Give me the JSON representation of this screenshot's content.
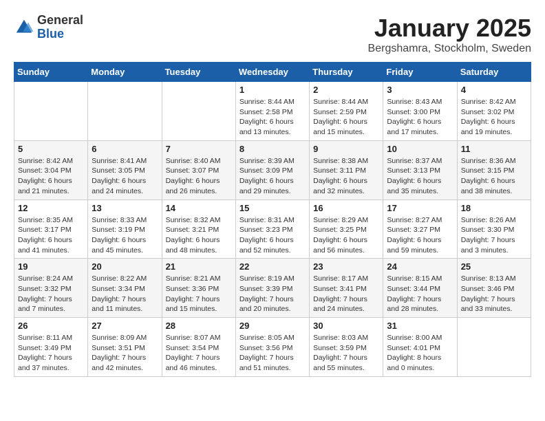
{
  "logo": {
    "general": "General",
    "blue": "Blue"
  },
  "header": {
    "title": "January 2025",
    "subtitle": "Bergshamra, Stockholm, Sweden"
  },
  "weekdays": [
    "Sunday",
    "Monday",
    "Tuesday",
    "Wednesday",
    "Thursday",
    "Friday",
    "Saturday"
  ],
  "weeks": [
    [
      {
        "day": "",
        "info": ""
      },
      {
        "day": "",
        "info": ""
      },
      {
        "day": "",
        "info": ""
      },
      {
        "day": "1",
        "info": "Sunrise: 8:44 AM\nSunset: 2:58 PM\nDaylight: 6 hours\nand 13 minutes."
      },
      {
        "day": "2",
        "info": "Sunrise: 8:44 AM\nSunset: 2:59 PM\nDaylight: 6 hours\nand 15 minutes."
      },
      {
        "day": "3",
        "info": "Sunrise: 8:43 AM\nSunset: 3:00 PM\nDaylight: 6 hours\nand 17 minutes."
      },
      {
        "day": "4",
        "info": "Sunrise: 8:42 AM\nSunset: 3:02 PM\nDaylight: 6 hours\nand 19 minutes."
      }
    ],
    [
      {
        "day": "5",
        "info": "Sunrise: 8:42 AM\nSunset: 3:04 PM\nDaylight: 6 hours\nand 21 minutes."
      },
      {
        "day": "6",
        "info": "Sunrise: 8:41 AM\nSunset: 3:05 PM\nDaylight: 6 hours\nand 24 minutes."
      },
      {
        "day": "7",
        "info": "Sunrise: 8:40 AM\nSunset: 3:07 PM\nDaylight: 6 hours\nand 26 minutes."
      },
      {
        "day": "8",
        "info": "Sunrise: 8:39 AM\nSunset: 3:09 PM\nDaylight: 6 hours\nand 29 minutes."
      },
      {
        "day": "9",
        "info": "Sunrise: 8:38 AM\nSunset: 3:11 PM\nDaylight: 6 hours\nand 32 minutes."
      },
      {
        "day": "10",
        "info": "Sunrise: 8:37 AM\nSunset: 3:13 PM\nDaylight: 6 hours\nand 35 minutes."
      },
      {
        "day": "11",
        "info": "Sunrise: 8:36 AM\nSunset: 3:15 PM\nDaylight: 6 hours\nand 38 minutes."
      }
    ],
    [
      {
        "day": "12",
        "info": "Sunrise: 8:35 AM\nSunset: 3:17 PM\nDaylight: 6 hours\nand 41 minutes."
      },
      {
        "day": "13",
        "info": "Sunrise: 8:33 AM\nSunset: 3:19 PM\nDaylight: 6 hours\nand 45 minutes."
      },
      {
        "day": "14",
        "info": "Sunrise: 8:32 AM\nSunset: 3:21 PM\nDaylight: 6 hours\nand 48 minutes."
      },
      {
        "day": "15",
        "info": "Sunrise: 8:31 AM\nSunset: 3:23 PM\nDaylight: 6 hours\nand 52 minutes."
      },
      {
        "day": "16",
        "info": "Sunrise: 8:29 AM\nSunset: 3:25 PM\nDaylight: 6 hours\nand 56 minutes."
      },
      {
        "day": "17",
        "info": "Sunrise: 8:27 AM\nSunset: 3:27 PM\nDaylight: 6 hours\nand 59 minutes."
      },
      {
        "day": "18",
        "info": "Sunrise: 8:26 AM\nSunset: 3:30 PM\nDaylight: 7 hours\nand 3 minutes."
      }
    ],
    [
      {
        "day": "19",
        "info": "Sunrise: 8:24 AM\nSunset: 3:32 PM\nDaylight: 7 hours\nand 7 minutes."
      },
      {
        "day": "20",
        "info": "Sunrise: 8:22 AM\nSunset: 3:34 PM\nDaylight: 7 hours\nand 11 minutes."
      },
      {
        "day": "21",
        "info": "Sunrise: 8:21 AM\nSunset: 3:36 PM\nDaylight: 7 hours\nand 15 minutes."
      },
      {
        "day": "22",
        "info": "Sunrise: 8:19 AM\nSunset: 3:39 PM\nDaylight: 7 hours\nand 20 minutes."
      },
      {
        "day": "23",
        "info": "Sunrise: 8:17 AM\nSunset: 3:41 PM\nDaylight: 7 hours\nand 24 minutes."
      },
      {
        "day": "24",
        "info": "Sunrise: 8:15 AM\nSunset: 3:44 PM\nDaylight: 7 hours\nand 28 minutes."
      },
      {
        "day": "25",
        "info": "Sunrise: 8:13 AM\nSunset: 3:46 PM\nDaylight: 7 hours\nand 33 minutes."
      }
    ],
    [
      {
        "day": "26",
        "info": "Sunrise: 8:11 AM\nSunset: 3:49 PM\nDaylight: 7 hours\nand 37 minutes."
      },
      {
        "day": "27",
        "info": "Sunrise: 8:09 AM\nSunset: 3:51 PM\nDaylight: 7 hours\nand 42 minutes."
      },
      {
        "day": "28",
        "info": "Sunrise: 8:07 AM\nSunset: 3:54 PM\nDaylight: 7 hours\nand 46 minutes."
      },
      {
        "day": "29",
        "info": "Sunrise: 8:05 AM\nSunset: 3:56 PM\nDaylight: 7 hours\nand 51 minutes."
      },
      {
        "day": "30",
        "info": "Sunrise: 8:03 AM\nSunset: 3:59 PM\nDaylight: 7 hours\nand 55 minutes."
      },
      {
        "day": "31",
        "info": "Sunrise: 8:00 AM\nSunset: 4:01 PM\nDaylight: 8 hours\nand 0 minutes."
      },
      {
        "day": "",
        "info": ""
      }
    ]
  ]
}
